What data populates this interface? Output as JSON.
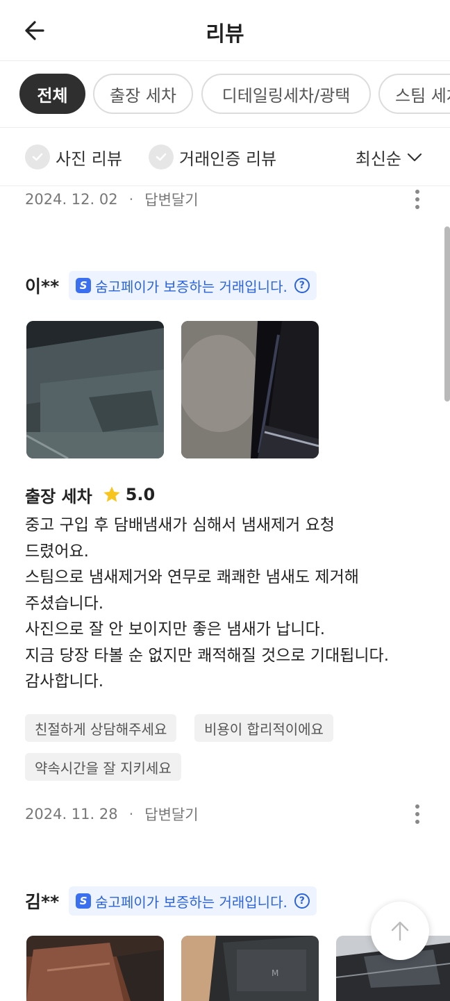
{
  "header": {
    "title": "리뷰"
  },
  "categories": [
    "전체",
    "출장 세차",
    "디테일링세차/광택",
    "스팀 세차"
  ],
  "filters": {
    "photo_review": "사진 리뷰",
    "verified_review": "거래인증 리뷰",
    "sort": "최신순"
  },
  "top_meta": {
    "date": "2024. 12. 02",
    "reply": "답변달기"
  },
  "reviews": [
    {
      "reviewer": "이**",
      "badge": "숨고페이가 보증하는 거래입니다.",
      "service": "출장 세차",
      "rating": "5.0",
      "lines": [
        "중고 구입 후 담배냄새가 심해서 냄새제거 요청",
        "드렸어요.",
        "스팀으로 냄새제거와 연무로 쾌쾌한 냄새도 제거해",
        "주셨습니다.",
        "사진으로 잘 안 보이지만 좋은 냄새가 납니다.",
        "지금 당장 타볼 순 없지만 쾌적해질 것으로 기대됩니다.",
        "감사합니다."
      ],
      "tags": [
        "친절하게 상담해주세요",
        "비용이 합리적이에요",
        "약속시간을 잘 지키세요"
      ],
      "date": "2024. 11. 28",
      "reply": "답변달기"
    },
    {
      "reviewer": "김**",
      "badge": "숨고페이가 보증하는 거래입니다."
    }
  ],
  "icons": {
    "back": "arrow-left-icon",
    "chevron": "chevron-down-icon",
    "check": "check-icon",
    "more": "more-vertical-icon",
    "pay": "soomgo-pay-icon",
    "help": "help-circle-icon",
    "star": "star-icon",
    "scroll_top": "arrow-up-icon"
  },
  "colors": {
    "accent_blue": "#2b63d9",
    "badge_bg": "#eef4ff",
    "star": "#f7c51e",
    "active_chip": "#2f2f2f"
  }
}
